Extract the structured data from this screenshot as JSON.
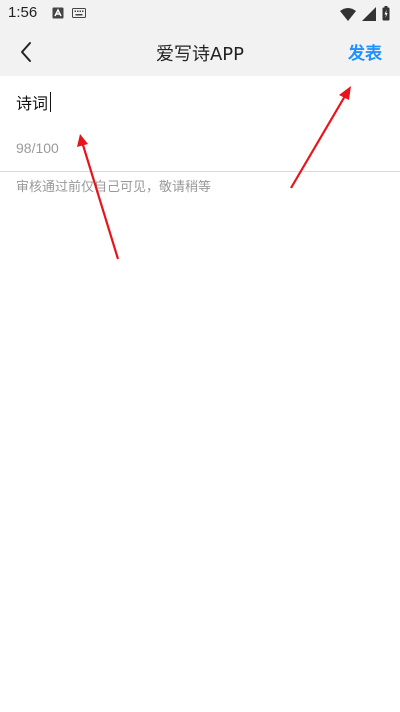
{
  "status_bar": {
    "time": "1:56",
    "left_icons": [
      "android-text-icon",
      "keyboard-icon"
    ],
    "right_icons": [
      "wifi-icon",
      "signal-icon",
      "battery-icon"
    ]
  },
  "header": {
    "title": "爱写诗APP",
    "back_icon": "chevron-left-icon",
    "publish_label": "发表"
  },
  "editor": {
    "text": "诗词",
    "counter": "98/100"
  },
  "notice": "审核通过前仅自己可见，敬请稍等",
  "colors": {
    "accent": "#1e90ff",
    "annotation_arrow": "#e8141b"
  }
}
